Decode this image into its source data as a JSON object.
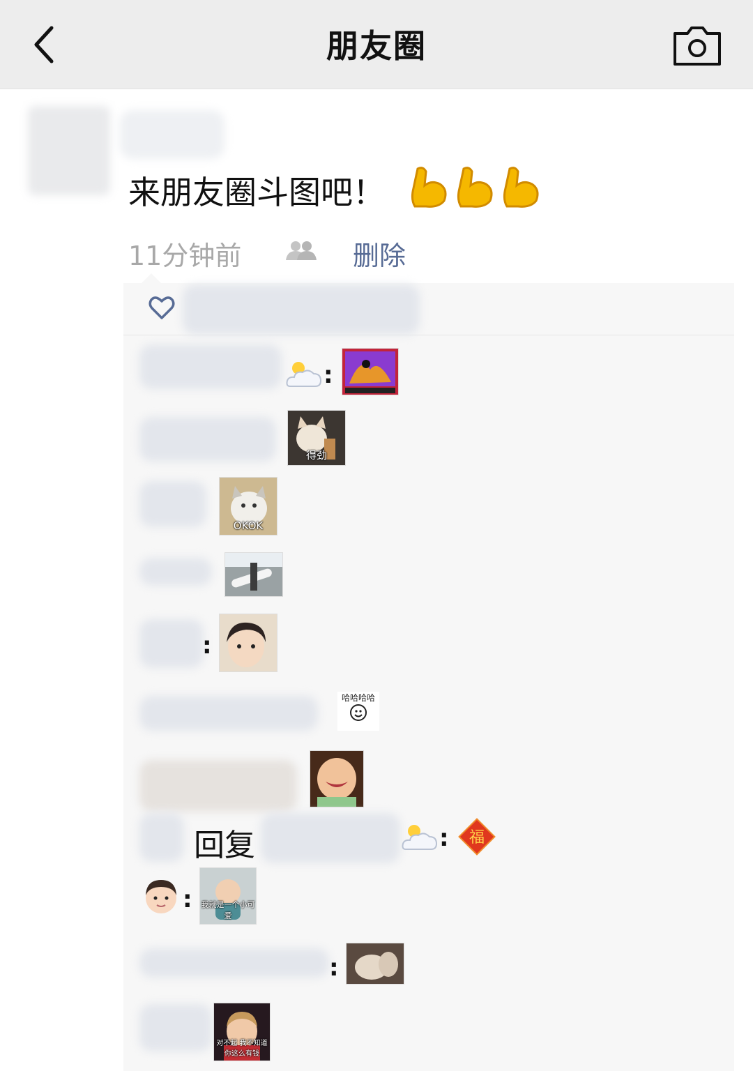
{
  "header": {
    "title": "朋友圈",
    "back_icon": "chevron-left-icon",
    "camera_icon": "camera-icon"
  },
  "post": {
    "text": "来朋友圈斗图吧！",
    "emoji": "flexed-biceps",
    "time": "11分钟前",
    "delete_label": "删除"
  },
  "comments": [
    {
      "emoji": "sun-behind-cloud",
      "sticker_caption": ""
    },
    {
      "sticker_caption": "得劲"
    },
    {
      "sticker_caption": "OKOK"
    },
    {
      "sticker_caption": ""
    },
    {
      "sticker_caption": ""
    },
    {
      "sticker_caption": "哈哈哈哈"
    },
    {
      "sticker_caption": ""
    },
    {
      "reply_label": "回复",
      "emoji": "sun-behind-cloud",
      "sticker": "福"
    },
    {
      "emoji": "boy",
      "sticker_caption": "我就是一个小可爱"
    },
    {
      "sticker_caption": ""
    },
    {
      "sticker_caption": "对不起 我不知道你这么有钱"
    }
  ],
  "colors": {
    "link": "#576b95",
    "header_bg": "#ededed",
    "panel_bg": "#f7f7f7"
  }
}
